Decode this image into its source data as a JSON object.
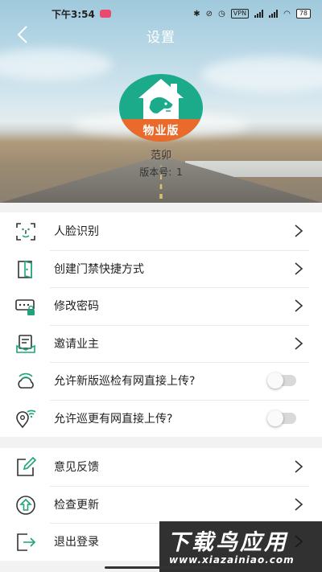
{
  "status_bar": {
    "time": "下午3:54",
    "vpn": "VPN",
    "battery": "78"
  },
  "header": {
    "title": "设置"
  },
  "profile": {
    "logo_badge": "物业版",
    "name": "范卯",
    "version_label": "版本号:",
    "version_value": "1"
  },
  "settings": {
    "items": [
      {
        "label": "人脸识别",
        "icon": "face-scan-icon",
        "control": "chevron"
      },
      {
        "label": "创建门禁快捷方式",
        "icon": "door-icon",
        "control": "chevron"
      },
      {
        "label": "修改密码",
        "icon": "password-lock-icon",
        "control": "chevron"
      },
      {
        "label": "邀请业主",
        "icon": "invite-owner-icon",
        "control": "chevron"
      },
      {
        "label": "允许新版巡检有网直接上传?",
        "icon": "cloud-wifi-icon",
        "control": "toggle",
        "toggle_on": false
      },
      {
        "label": "允许巡更有网直接上传?",
        "icon": "location-wifi-icon",
        "control": "toggle",
        "toggle_on": false
      }
    ]
  },
  "more": {
    "items": [
      {
        "label": "意见反馈",
        "icon": "feedback-edit-icon",
        "control": "chevron"
      },
      {
        "label": "检查更新",
        "icon": "update-arrow-icon",
        "control": "chevron"
      },
      {
        "label": "退出登录",
        "icon": "logout-icon",
        "control": "chevron"
      }
    ]
  },
  "watermark": {
    "title": "下载鸟应用",
    "url": "www.xiazainiao.com"
  },
  "colors": {
    "accent": "#1bab8a",
    "badge_orange": "#e96a2a",
    "icon_green": "#1fa37c"
  }
}
